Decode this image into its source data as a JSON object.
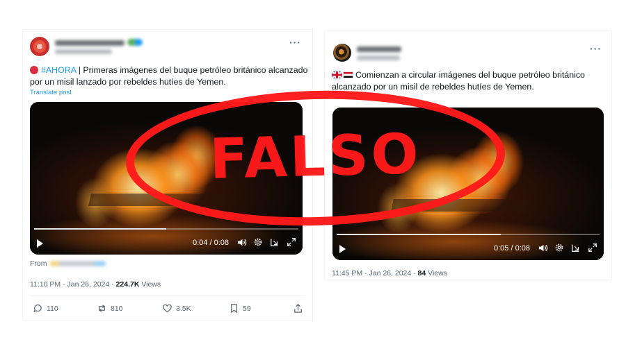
{
  "left_post": {
    "hashtag": "#AHORA",
    "text": " | Primeras imágenes del buque petróleo británico alcanzado por un misil lanzado por rebeldes hutíes de Yemen.",
    "translate_label": "Translate post",
    "video": {
      "time": "0:04 / 0:08",
      "progress": 0.5
    },
    "from_label": "From",
    "timestamp": "11:10 PM · Jan 26, 2024 · ",
    "views_count": "224.7K",
    "views_label": " Views",
    "actions": {
      "replies": "110",
      "reposts": "810",
      "likes": "3.5K",
      "bookmarks": "59"
    }
  },
  "right_post": {
    "text": "Comienzan a circular imágenes del buque petróleo británico alcanzado por un misil de rebeldes hutíes de Yemen.",
    "video": {
      "time": "0:05 / 0:08",
      "progress": 0.625
    },
    "timestamp": "11:45 PM · Jan 26, 2024 · ",
    "views_count": "84",
    "views_label": " Views"
  },
  "stamp": {
    "text": "FALSO",
    "color": "#ff1a1a"
  },
  "colors": {
    "link": "#1d9bf0",
    "muted": "#536471",
    "text": "#0f1419"
  }
}
